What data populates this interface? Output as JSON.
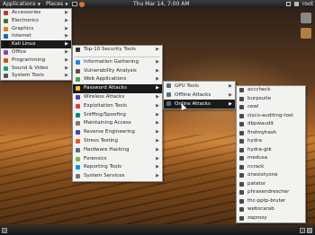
{
  "top_panel": {
    "applications": "Applications",
    "places": "Places",
    "clock": "Thu Mar 14,  7:00 AM",
    "user": "root"
  },
  "applications_menu": [
    {
      "label": "Accessories",
      "icon_color": "#c0392b",
      "icon": "accessories-icon"
    },
    {
      "label": "Electronics",
      "icon_color": "#2e7d32",
      "icon": "electronics-icon"
    },
    {
      "label": "Graphics",
      "icon_color": "#e67e22",
      "icon": "graphics-icon"
    },
    {
      "label": "Internet",
      "icon_color": "#1565c0",
      "icon": "internet-icon"
    },
    {
      "label": "Kali Linux",
      "icon_color": "#111111",
      "icon": "kali-icon",
      "active": true
    },
    {
      "label": "Office",
      "icon_color": "#8e44ad",
      "icon": "office-icon"
    },
    {
      "label": "Programming",
      "icon_color": "#d35400",
      "icon": "programming-icon"
    },
    {
      "label": "Sound & Video",
      "icon_color": "#16a085",
      "icon": "sound-video-icon"
    },
    {
      "label": "System Tools",
      "icon_color": "#555555",
      "icon": "system-tools-icon"
    }
  ],
  "kali_menu": {
    "top_item": "Top-10 Security Tools",
    "items": [
      {
        "label": "Information Gathering",
        "icon_color": "#1e88e5"
      },
      {
        "label": "Vulnerability Analysis",
        "icon_color": "#6d4c41"
      },
      {
        "label": "Web Applications",
        "icon_color": "#43a047"
      },
      {
        "label": "Password Attacks",
        "icon_color": "#fbc02d",
        "active": true
      },
      {
        "label": "Wireless Attacks",
        "icon_color": "#5e35b1"
      },
      {
        "label": "Exploitation Tools",
        "icon_color": "#e53935"
      },
      {
        "label": "Sniffing/Spoofing",
        "icon_color": "#00897b"
      },
      {
        "label": "Maintaining Access",
        "icon_color": "#8d6e63"
      },
      {
        "label": "Reverse Engineering",
        "icon_color": "#3949ab"
      },
      {
        "label": "Stress Testing",
        "icon_color": "#f4511e"
      },
      {
        "label": "Hardware Hacking",
        "icon_color": "#546e7a"
      },
      {
        "label": "Forensics",
        "icon_color": "#7cb342"
      },
      {
        "label": "Reporting Tools",
        "icon_color": "#039be5"
      },
      {
        "label": "System Services",
        "icon_color": "#757575"
      }
    ]
  },
  "password_menu": [
    {
      "label": "GPU Tools",
      "icon_color": "#546e7a"
    },
    {
      "label": "Offline Attacks",
      "icon_color": "#546e7a"
    },
    {
      "label": "Online Attacks",
      "icon_color": "#546e7a",
      "active": true
    }
  ],
  "online_attacks_menu": [
    "acccheck",
    "burpsuite",
    "cewl",
    "cisco-auditing-tool",
    "dbpwaudit",
    "findmyhash",
    "hydra",
    "hydra-gtk",
    "medusa",
    "ncrack",
    "onesixtyone",
    "patator",
    "phrasendrescher",
    "thc-pptp-bruter",
    "webscarab",
    "zaproxy"
  ]
}
